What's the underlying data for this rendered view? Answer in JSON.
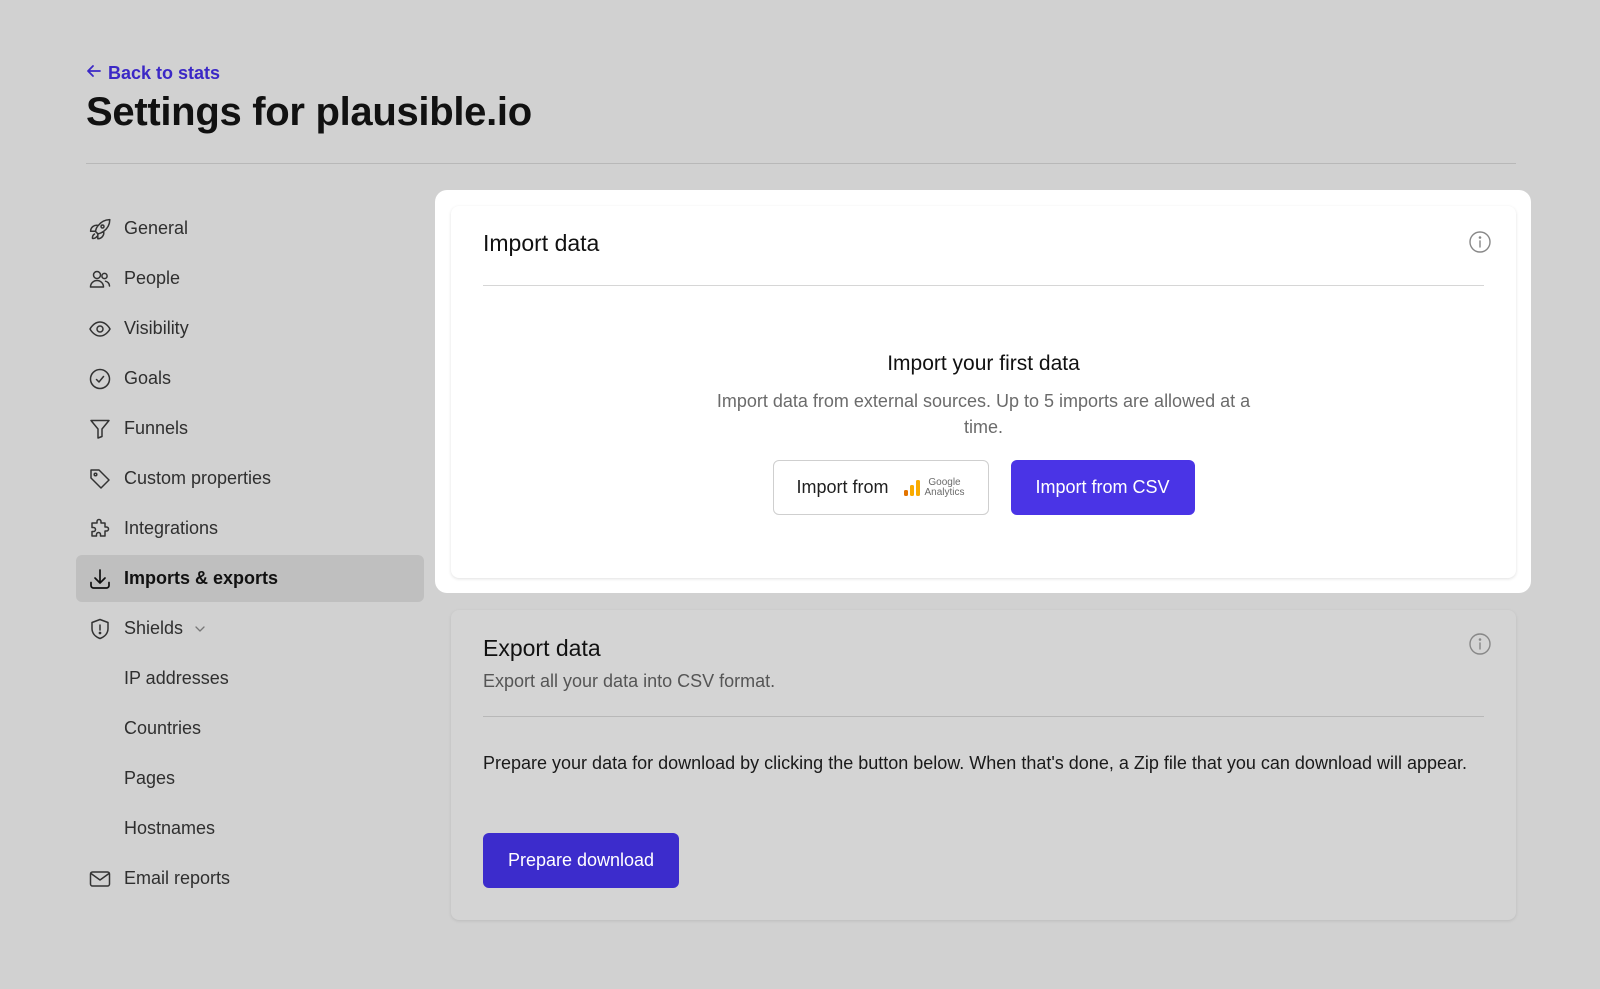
{
  "header": {
    "back_label": "Back to stats",
    "title": "Settings for plausible.io"
  },
  "sidebar": {
    "items": [
      {
        "label": "General",
        "icon": "rocket-icon"
      },
      {
        "label": "People",
        "icon": "users-icon"
      },
      {
        "label": "Visibility",
        "icon": "eye-icon"
      },
      {
        "label": "Goals",
        "icon": "check-circle-icon"
      },
      {
        "label": "Funnels",
        "icon": "funnel-icon"
      },
      {
        "label": "Custom properties",
        "icon": "tag-icon"
      },
      {
        "label": "Integrations",
        "icon": "puzzle-icon"
      },
      {
        "label": "Imports & exports",
        "icon": "download-icon",
        "active": true
      },
      {
        "label": "Shields",
        "icon": "shield-exclamation-icon"
      },
      {
        "label": "IP addresses"
      },
      {
        "label": "Countries"
      },
      {
        "label": "Pages"
      },
      {
        "label": "Hostnames"
      },
      {
        "label": "Email reports",
        "icon": "envelope-icon"
      }
    ]
  },
  "import": {
    "title": "Import data",
    "empty_title": "Import your first data",
    "empty_desc": "Import data from external sources. Up to 5 imports are allowed at a time.",
    "ga_button_label": "Import from",
    "ga_logo_line1": "Google",
    "ga_logo_line2": "Analytics",
    "csv_button_label": "Import from CSV"
  },
  "export": {
    "title": "Export data",
    "desc": "Export all your data into CSV format.",
    "body": "Prepare your data for download by clicking the button below. When that's done, a Zip file that you can download will appear.",
    "button_label": "Prepare download"
  },
  "colors": {
    "accent": "#4a34e6",
    "accent_dark": "#3c2ccc",
    "link": "#3b28c6",
    "background": "#d1d1d1"
  }
}
